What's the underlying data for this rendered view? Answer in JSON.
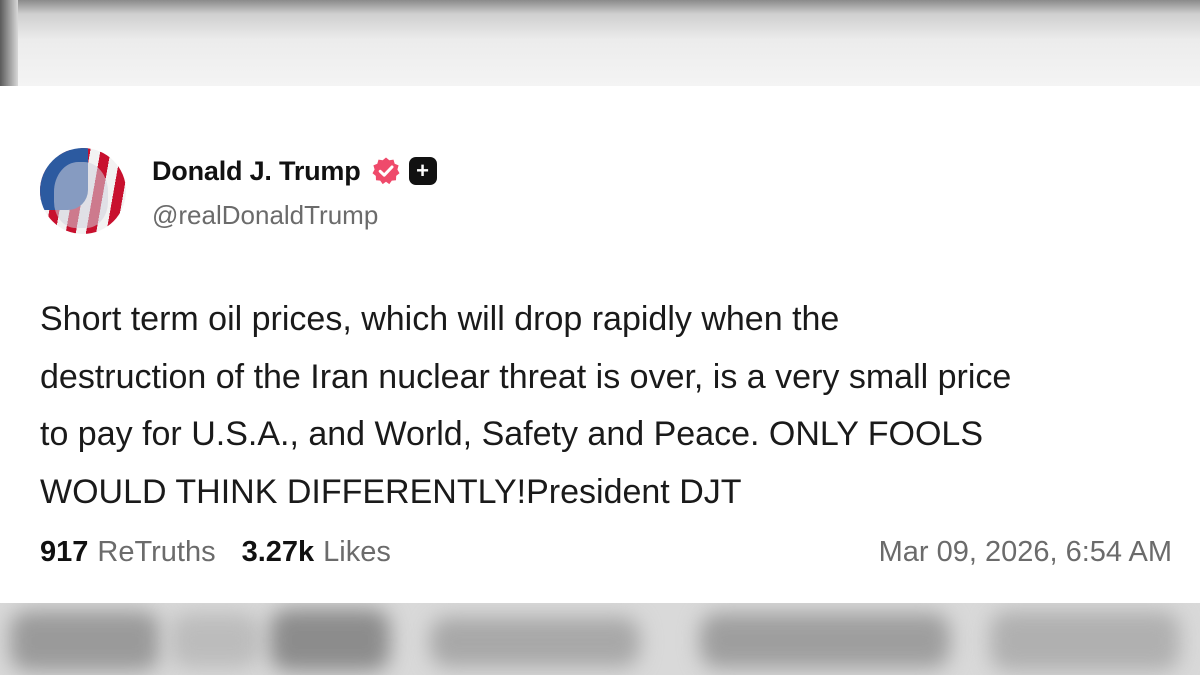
{
  "post": {
    "author": {
      "display_name": "Donald J. Trump",
      "handle": "@realDonaldTrump",
      "avatar_icon": "flag-portrait-avatar",
      "verified_icon": "verified-badge-icon",
      "verified_color": "#ef4a6b",
      "extra_badge_icon": "plus-badge-icon",
      "extra_badge_glyph": "+"
    },
    "text_lines": [
      "Short term oil prices, which will drop rapidly when the",
      "destruction of the Iran nuclear threat is over, is a very small price",
      "to pay for U.S.A., and World, Safety and Peace. ONLY FOOLS",
      "WOULD THINK DIFFERENTLY!President DJT"
    ],
    "stats": {
      "retruths_count": "917",
      "retruths_label": "ReTruths",
      "likes_count": "3.27k",
      "likes_label": "Likes"
    },
    "timestamp": "Mar 09, 2026, 6:54 AM"
  }
}
